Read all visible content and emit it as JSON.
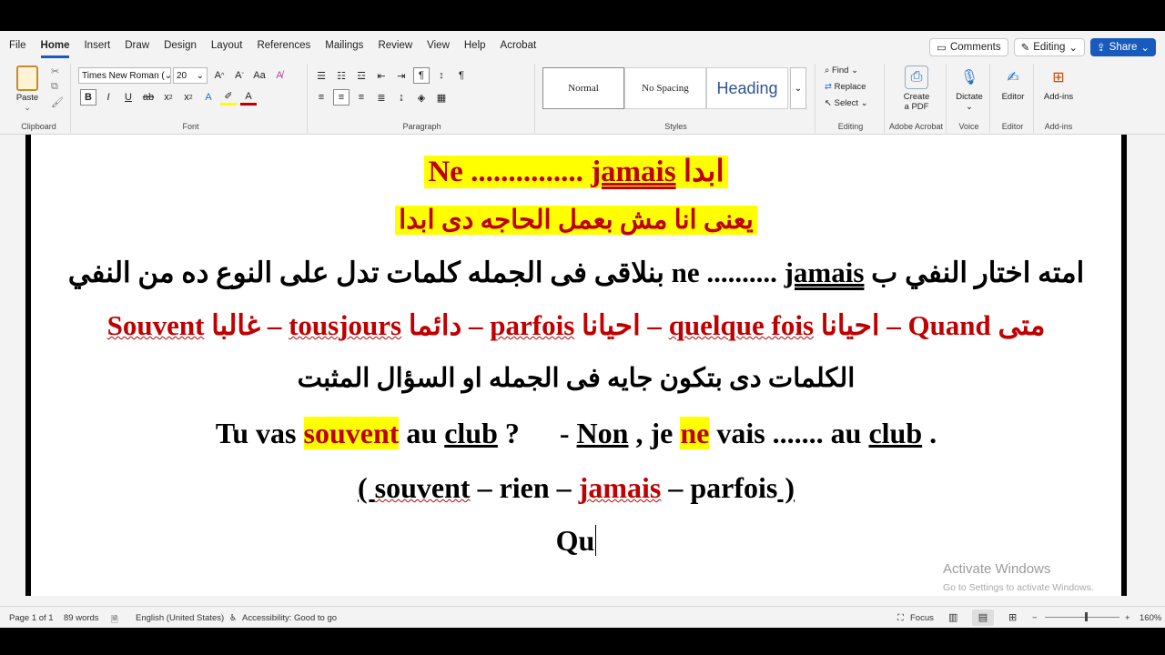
{
  "menu": {
    "tabs": [
      "File",
      "Home",
      "Insert",
      "Draw",
      "Design",
      "Layout",
      "References",
      "Mailings",
      "Review",
      "View",
      "Help",
      "Acrobat"
    ],
    "active": "Home",
    "comments_label": "Comments",
    "editing_label": "Editing",
    "share_label": "Share"
  },
  "ribbon": {
    "clipboard": {
      "paste_label": "Paste",
      "group_label": "Clipboard"
    },
    "font": {
      "family": "Times New Roman (",
      "size": "20",
      "group_label": "Font"
    },
    "paragraph": {
      "group_label": "Paragraph"
    },
    "styles": {
      "items": [
        "Normal",
        "No Spacing",
        "Heading"
      ],
      "group_label": "Styles"
    },
    "editing": {
      "find_label": "Find",
      "replace_label": "Replace",
      "select_label": "Select",
      "group_label": "Editing"
    },
    "acrobat": {
      "create_label_1": "Create",
      "create_label_2": "a PDF",
      "group_label": "Adobe Acrobat"
    },
    "voice": {
      "dictate_label": "Dictate",
      "group_label": "Voice"
    },
    "editor": {
      "editor_label": "Editor",
      "group_label": "Editor"
    },
    "addins": {
      "addins_label": "Add-ins",
      "group_label": "Add-ins"
    }
  },
  "document": {
    "line1": {
      "ne": "Ne ",
      "dots": "............... ",
      "jamais": "jamais",
      "arabic": " ابدا"
    },
    "line2": "يعنى انا مش بعمل الحاجه دى ابدا",
    "line3": {
      "part1": "امته اختار النفي ب ",
      "jamais": "jamais",
      "dots": " .......... ",
      "ne": "ne",
      "part2": " بنلاقى فى الجمله كلمات تدل على النوع ده من النفي"
    },
    "line4": {
      "mata": "متى ",
      "quand": "Quand",
      "d1": " – احيانا ",
      "quelque": "quelque fois",
      "d2": " – احيانا ",
      "parfois": "parfois",
      "d3": " – دائما ",
      "tousjours": "tousjours",
      "d4": " – غالبا ",
      "souvent": "Souvent"
    },
    "line5": "الكلمات دى بتكون جايه فى الجمله او السؤال المثبت",
    "line6": {
      "tu": "Tu vas ",
      "souvent": "souvent",
      "au": " au ",
      "club": "club",
      "q": " ?",
      "dash": "- ",
      "non": "Non",
      "je": " , je ",
      "ne": "ne",
      "vais": " vais ....... au ",
      "club2": "club",
      "end": " ."
    },
    "line7": {
      "open": "( ",
      "souvent": "souvent",
      "rien": " – rien – ",
      "jamais": "jamais",
      "rest": " – parfois",
      "close": " )"
    },
    "line8": "Qu"
  },
  "watermark": {
    "title": "Activate Windows",
    "subtitle": "Go to Settings to activate Windows."
  },
  "status": {
    "page": "Page 1 of 1",
    "words": "89 words",
    "language": "English (United States)",
    "accessibility": "Accessibility: Good to go",
    "focus": "Focus",
    "zoom": "160%"
  },
  "colors": {
    "accent": "#185abd",
    "highlight": "#ffff00",
    "red_text": "#c00000"
  }
}
